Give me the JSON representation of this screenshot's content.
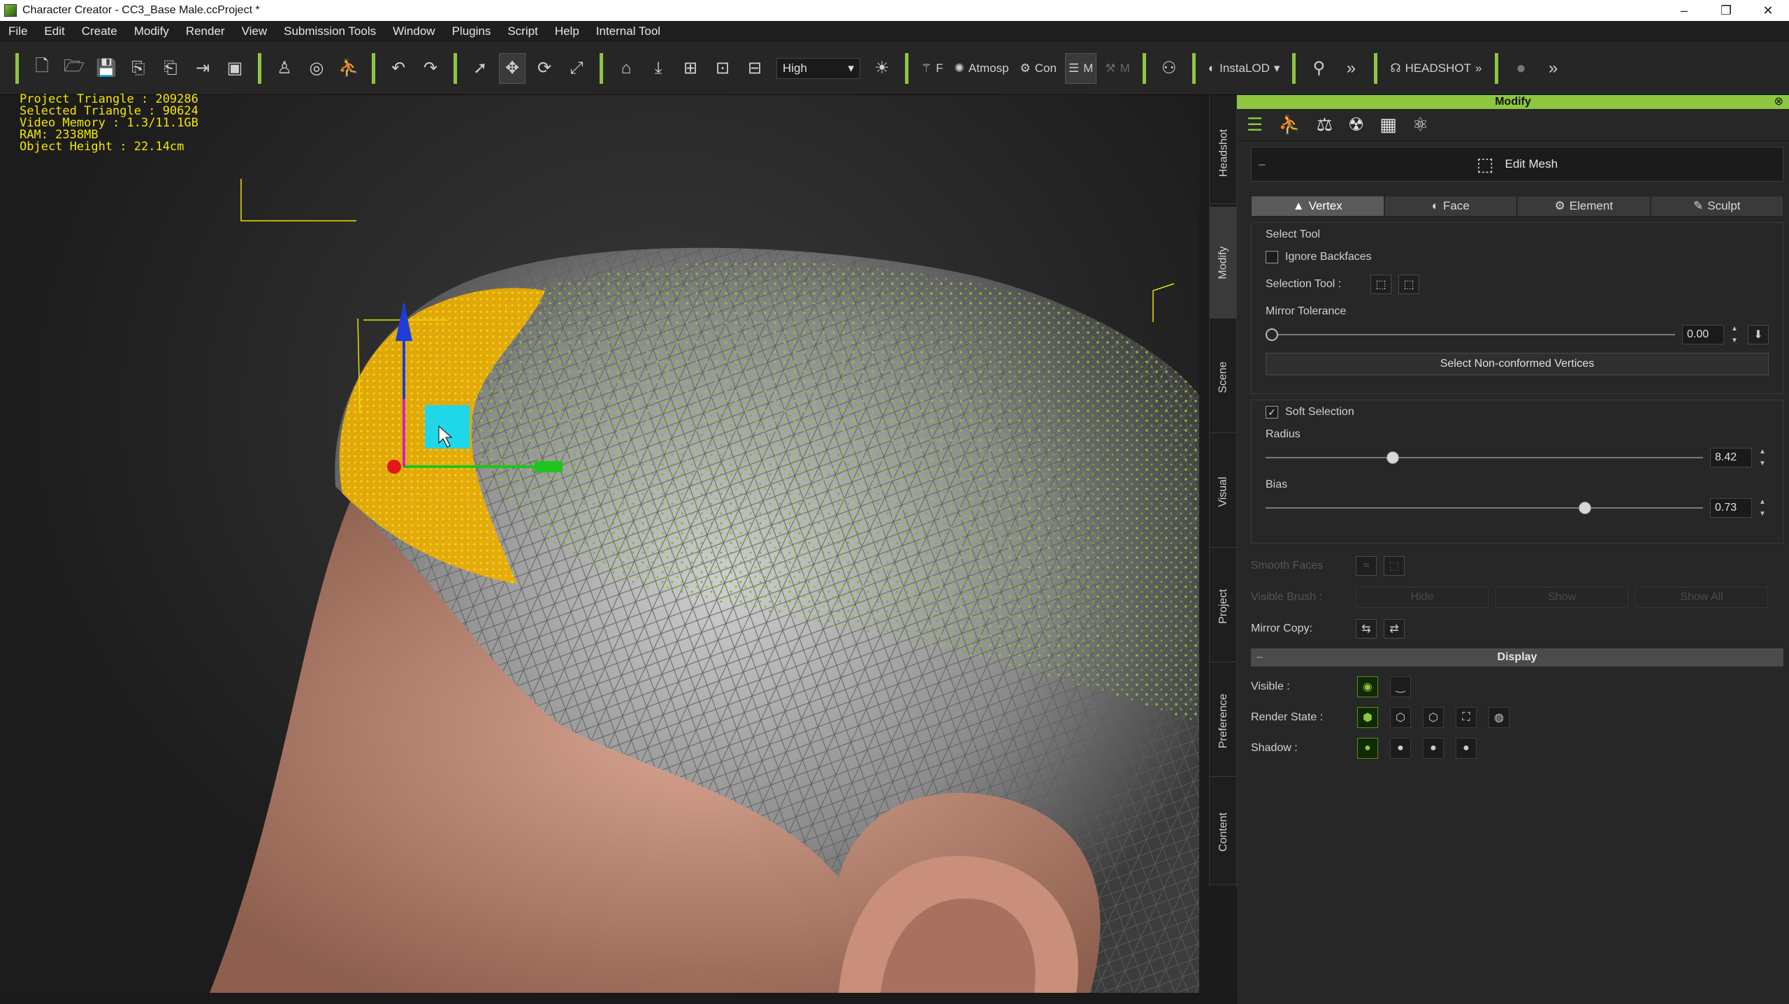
{
  "window": {
    "title": "Character Creator - CC3_Base Male.ccProject *",
    "min": "–",
    "max": "❐",
    "close": "✕"
  },
  "menu": [
    "File",
    "Edit",
    "Create",
    "Modify",
    "Render",
    "View",
    "Submission Tools",
    "Window",
    "Plugins",
    "Script",
    "Help",
    "Internal Tool"
  ],
  "toolbar": {
    "quality": "High",
    "atmosphere": "Atmosp",
    "con": "Con",
    "m_label": "M",
    "instalod": "InstaLOD",
    "headshot": "HEADSHOT",
    "f_label": "F",
    "m2_label": "M"
  },
  "stats": {
    "project_triangle": "Project Triangle : 209286",
    "selected_triangle": "Selected Triangle : 90624",
    "video_memory": "Video Memory : 1.3/11.1GB",
    "ram": "RAM: 2338MB",
    "object_height": "Object Height : 22.14cm"
  },
  "side_tabs": [
    "Headshot",
    "Modify",
    "Scene",
    "Visual",
    "Project",
    "Preference",
    "Content"
  ],
  "panel": {
    "title": "Modify",
    "close": "⊗",
    "edit_mesh": "Edit Mesh",
    "modes": [
      "Vertex",
      "Face",
      "Element",
      "Sculpt"
    ],
    "select_tool": {
      "title": "Select Tool",
      "ignore_backfaces": "Ignore Backfaces",
      "selection_tool": "Selection Tool :",
      "mirror_tolerance": "Mirror Tolerance",
      "mirror_tolerance_value": "0.00",
      "mirror_tolerance_level": 0,
      "select_non_conformed": "Select Non-conformed Vertices"
    },
    "soft_selection": {
      "label": "Soft Selection",
      "checked": true,
      "radius_label": "Radius",
      "radius_value": "8.42",
      "radius_level": 0.29,
      "bias_label": "Bias",
      "bias_value": "0.73",
      "bias_level": 0.73
    },
    "smooth_faces": "Smooth Faces",
    "visible_brush": "Visible Brush :",
    "hide": "Hide",
    "show": "Show",
    "show_all": "Show All",
    "mirror_copy": "Mirror Copy:",
    "display": {
      "title": "Display",
      "visible": "Visible :",
      "render_state": "Render State :",
      "shadow": "Shadow :"
    }
  },
  "colors": {
    "accent": "#8dc63f",
    "stats_text": "#f2e600",
    "gizmo_x": "#1fc41f",
    "gizmo_y": "#1d3cd8",
    "gizmo_origin": "#e01818",
    "gizmo_plane": "#1fd7e8"
  }
}
